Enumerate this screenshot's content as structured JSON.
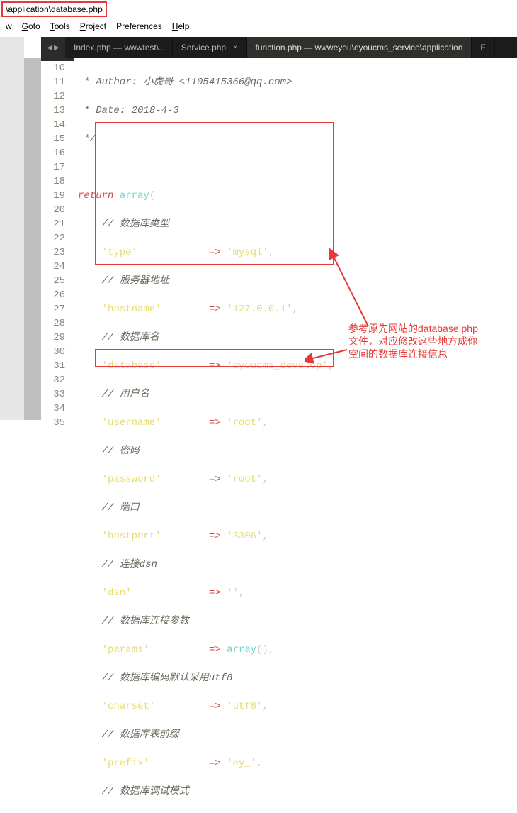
{
  "pathbar": "\\application\\database.php",
  "menu": {
    "items": [
      "w",
      "Goto",
      "Tools",
      "Project",
      "Preferences",
      "Help"
    ]
  },
  "tabs": [
    {
      "label": "Index.php — wwwtest\\..",
      "close": "",
      "active": false
    },
    {
      "label": "Service.php",
      "close": "×",
      "active": false
    },
    {
      "label": "function.php — wwweyou\\eyoucms_service\\application",
      "close": "",
      "active": true
    },
    {
      "label": "F",
      "close": "",
      "active": false
    }
  ],
  "lines": {
    "start": 10,
    "end": 35
  },
  "code": {
    "l10": " * Author: 小虎哥 <1105415366@qq.com>",
    "l11": " * Date: 2018-4-3",
    "l12": " */",
    "l13": "",
    "l14_kw": "return",
    "l14_fn": "array",
    "l14_par": "(",
    "l15": "    // 数据库类型",
    "l16_k": "'type'",
    "l16_v": "'mysql'",
    "l17": "    // 服务器地址",
    "l18_k": "'hostname'",
    "l18_v": "'127.0.0.1'",
    "l19": "    // 数据库名",
    "l20_k": "'database'",
    "l20_v": "'eyoucms_develop'",
    "l21": "    // 用户名",
    "l22_k": "'username'",
    "l22_v": "'root'",
    "l23": "    // 密码",
    "l24_k": "'password'",
    "l24_v": "'root'",
    "l25": "    // 端口",
    "l26_k": "'hostport'",
    "l26_v": "'3306'",
    "l27": "    // 连接dsn",
    "l28_k": "'dsn'",
    "l28_v": "''",
    "l29": "    // 数据库连接参数",
    "l30_k": "'params'",
    "l30_fn": "array",
    "l30_par": "()",
    "l31": "    // 数据库编码默认采用utf8",
    "l32_k": "'charset'",
    "l32_v": "'utf8'",
    "l33": "    // 数据库表前缀",
    "l34_k": "'prefix'",
    "l34_v": "'ey_'",
    "l35": "    // 数据库调试模式",
    "arrow": "=>",
    "comma": ","
  },
  "annotation": {
    "line1": "参考原先网站的database.php",
    "line2": "文件，对应修改这些地方成你",
    "line3": "空间的数据库连接信息"
  }
}
